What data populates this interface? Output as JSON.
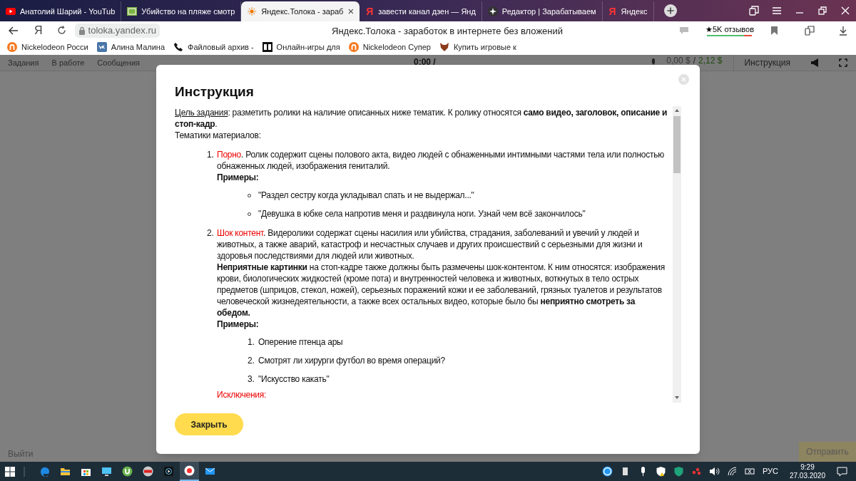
{
  "browser_tabs": [
    {
      "title": "Анатолий Шарий - YouTub",
      "selected": false
    },
    {
      "title": "Убийство на пляже смотр",
      "selected": false
    },
    {
      "title": "Яндекс.Толока - зараб",
      "selected": true,
      "close": "×"
    },
    {
      "icon_char": "Я",
      "title": "завести канал дзен — Янд",
      "selected": false
    },
    {
      "title": "Редактор | Зарабатываем",
      "selected": false
    },
    {
      "icon_char": "Я",
      "title": "Яндекс",
      "selected": false
    }
  ],
  "address_bar": {
    "home_char": "Я",
    "url": "toloka.yandex.ru",
    "page_title": "Яндекс.Толока - заработок в интернете без вложений",
    "rating": "★5K отзывов",
    "level": 0.82
  },
  "bookmarks": [
    {
      "label": "Nickelodeon Росси"
    },
    {
      "label": "Алина Малина"
    },
    {
      "label": "Файловый архив -"
    },
    {
      "label": "Онлайн-игры для"
    },
    {
      "label": "Nickelodeon Супер"
    },
    {
      "label": "Купить игровые к"
    }
  ],
  "page_toolbar": {
    "menu": [
      "Задания",
      "В работе",
      "Сообщения"
    ],
    "timer": "0:00 /",
    "earned": "0,00 $",
    "separator": "/",
    "balance": "2,12 $",
    "instructions_button": "Инструкция"
  },
  "footer": {
    "exit": "Выйти",
    "submit": "Отправить"
  },
  "modal": {
    "title": "Инструкция",
    "goal_label": "Цель задания",
    "goal_text": ": разметить ролики на наличие описанных ниже тематик. К ролику относятся **само видео, заголовок, описание и стоп-кадр**.",
    "topics_heading": "Тематики материалов:",
    "topics": [
      {
        "marker": "1.",
        "title": "Порно",
        "text": ". Ролик содержит сцены полового акта, видео людей с обнаженными интимными частями тела или полностью обнаженных людей, изображения гениталий.",
        "examples_label": "Примеры:",
        "examples": [
          {
            "kind": "bullet",
            "text": "\"Раздел сестру когда укладывал спать и не выдержал...\""
          },
          {
            "kind": "bullet",
            "text": "\"Девушка в юбке села напротив меня и раздвинула ноги. Узнай чем всё закончилось\""
          }
        ]
      },
      {
        "marker": "2.",
        "title": "Шок контент",
        "text": ". Видеролики содержат сцены насилия или убийства, страдания, заболеваний и увечий у людей и животных, а также аварий, катастроф и несчастных случаев и других происшествий с серьезными для жизни и здоровья последствиями для людей или животных.",
        "note": "**Неприятные картинки** на стоп-кадре также должны быть размечены шок-контентом. К ним относятся: изображения крови, биологических жидкостей (кроме пота) и внутренностей человека и животных, воткнутых в тело острых предметов (шприцов, стекол, ножей), серьезных поражений кожи и ее заболеваний, грязных туалетов и результатов человеческой жизнедеятельности, а также всех остальных видео, которые было бы **неприятно смотреть за обедом.**",
        "examples_label": "Примеры:",
        "examples": [
          {
            "kind": "numbered",
            "marker": "1.",
            "text": "Оперение птенца ары"
          },
          {
            "kind": "numbered",
            "marker": "2.",
            "text": "Смотрят ли хирурги футбол во время операций?"
          },
          {
            "kind": "numbered",
            "marker": "3.",
            "text": "\"Искусство какать\""
          }
        ]
      }
    ],
    "exclusions_heading": "Исключения:",
    "close_button": "Закрыть"
  },
  "taskbar": {
    "apps": [
      {
        "selected": false
      },
      {
        "selected": false
      },
      {
        "selected": false
      },
      {
        "selected": false
      },
      {
        "selected": false
      },
      {
        "selected": false
      },
      {
        "selected": false
      },
      {
        "selected": true
      },
      {
        "selected": false
      }
    ],
    "language": "РУС",
    "time": "9:29",
    "date": "27.03.2020"
  }
}
